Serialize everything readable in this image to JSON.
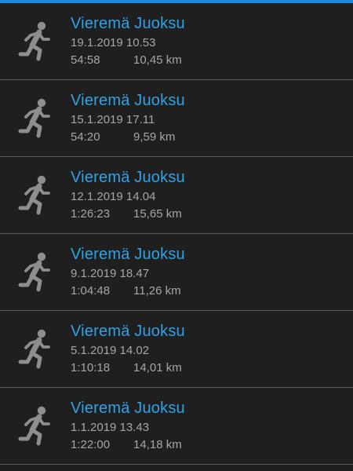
{
  "accent_color": "#1e88e5",
  "title_color": "#2ea3e6",
  "activities": [
    {
      "title": "Vieremä Juoksu",
      "date": "19.1.2019 10.53",
      "duration": "54:58",
      "distance": "10,45 km",
      "icon": "running-icon"
    },
    {
      "title": "Vieremä Juoksu",
      "date": "15.1.2019 17.11",
      "duration": "54:20",
      "distance": "9,59 km",
      "icon": "running-icon"
    },
    {
      "title": "Vieremä Juoksu",
      "date": "12.1.2019 14.04",
      "duration": "1:26:23",
      "distance": "15,65 km",
      "icon": "running-icon"
    },
    {
      "title": "Vieremä Juoksu",
      "date": "9.1.2019 18.47",
      "duration": "1:04:48",
      "distance": "11,26 km",
      "icon": "running-icon"
    },
    {
      "title": "Vieremä Juoksu",
      "date": "5.1.2019 14.02",
      "duration": "1:10:18",
      "distance": "14,01 km",
      "icon": "running-icon"
    },
    {
      "title": "Vieremä Juoksu",
      "date": "1.1.2019 13.43",
      "duration": "1:22:00",
      "distance": "14,18 km",
      "icon": "running-icon"
    }
  ]
}
